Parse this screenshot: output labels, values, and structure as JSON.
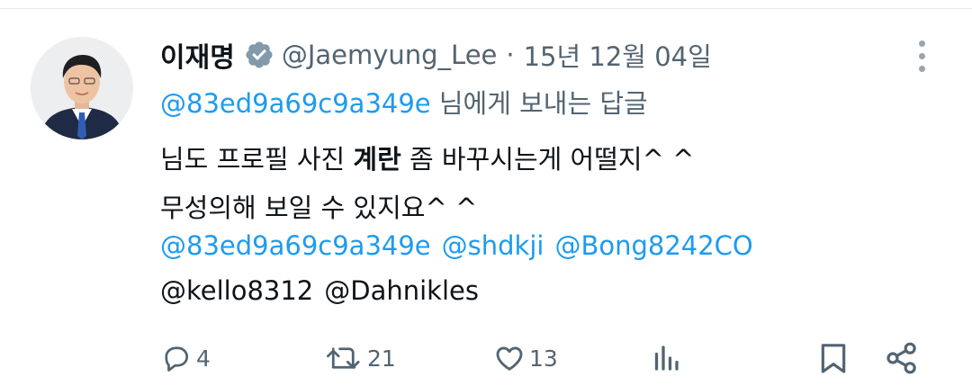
{
  "author": {
    "display_name": "이재명",
    "handle": "@Jaemyung_Lee",
    "separator": "·",
    "date": "15년 12월 04일"
  },
  "reply_to": {
    "handle": "@83ed9a69c9a349e",
    "suffix": "님에게 보내는 답글"
  },
  "body": {
    "line1_before": "님도 프로필 사진 ",
    "line1_bold": "계란",
    "line1_after": " 좀 바꾸시는게 어떨지^ ^",
    "line2": "무성의해 보일 수 있지요^ ^"
  },
  "mentions": {
    "line1": [
      "@83ed9a69c9a349e",
      "@shdkji",
      "@Bong8242CO"
    ],
    "line2": [
      "@kello8312",
      "@Dahnikles"
    ]
  },
  "actions": {
    "reply_count": "4",
    "retweet_count": "21",
    "like_count": "13"
  },
  "icons": {
    "verified": "verified-badge-icon",
    "more": "more-options-icon",
    "reply": "reply-icon",
    "retweet": "retweet-icon",
    "like": "heart-icon",
    "views": "analytics-icon",
    "bookmark": "bookmark-icon",
    "share": "share-icon"
  },
  "colors": {
    "link": "#1d9bf0",
    "secondary_text": "#536471",
    "primary_text": "#0f1419",
    "verified_badge": "#829aab"
  }
}
